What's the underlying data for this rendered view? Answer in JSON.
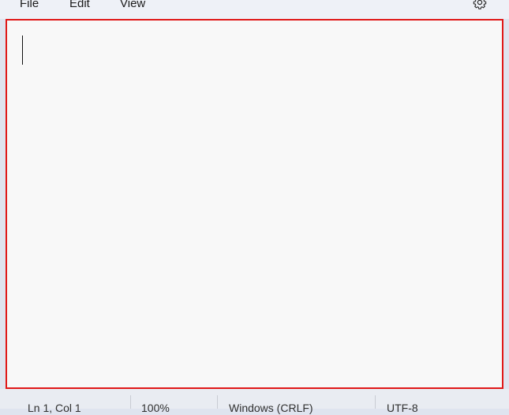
{
  "menubar": {
    "items": [
      {
        "label": "File"
      },
      {
        "label": "Edit"
      },
      {
        "label": "View"
      }
    ],
    "settings_icon": "gear-icon"
  },
  "editor": {
    "content": ""
  },
  "statusbar": {
    "position": "Ln 1, Col 1",
    "zoom": "100%",
    "line_ending": "Windows (CRLF)",
    "encoding": "UTF-8"
  },
  "colors": {
    "highlight_border": "#e01818",
    "editor_background": "#f8f8f8",
    "chrome_background": "#eef1f7"
  }
}
